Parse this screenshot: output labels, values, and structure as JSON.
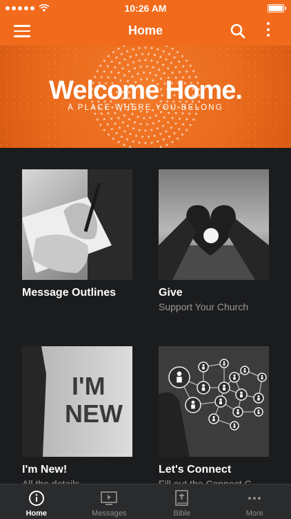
{
  "status_bar": {
    "time": "10:26 AM"
  },
  "nav": {
    "title": "Home"
  },
  "banner": {
    "title": "Welcome Home.",
    "subtitle": "A PLACE WHERE YOU BELONG"
  },
  "tiles": [
    {
      "title": "Message Outlines",
      "subtitle": ""
    },
    {
      "title": "Give",
      "subtitle": "Support Your Church"
    },
    {
      "title": "I'm New!",
      "subtitle": "All the details"
    },
    {
      "title": "Let's Connect",
      "subtitle": "Fill out the Connect C"
    }
  ],
  "tile_images": {
    "im_new_text_1": "I'M",
    "im_new_text_2": "NEW"
  },
  "tabs": [
    {
      "label": "Home",
      "icon": "info-icon",
      "active": true
    },
    {
      "label": "Messages",
      "icon": "video-icon",
      "active": false
    },
    {
      "label": "Bible",
      "icon": "bible-icon",
      "active": false
    },
    {
      "label": "More",
      "icon": "more-icon",
      "active": false
    }
  ],
  "colors": {
    "accent": "#f26a1b",
    "background": "#1b1c1e",
    "tabbar": "#2a2b2d"
  }
}
